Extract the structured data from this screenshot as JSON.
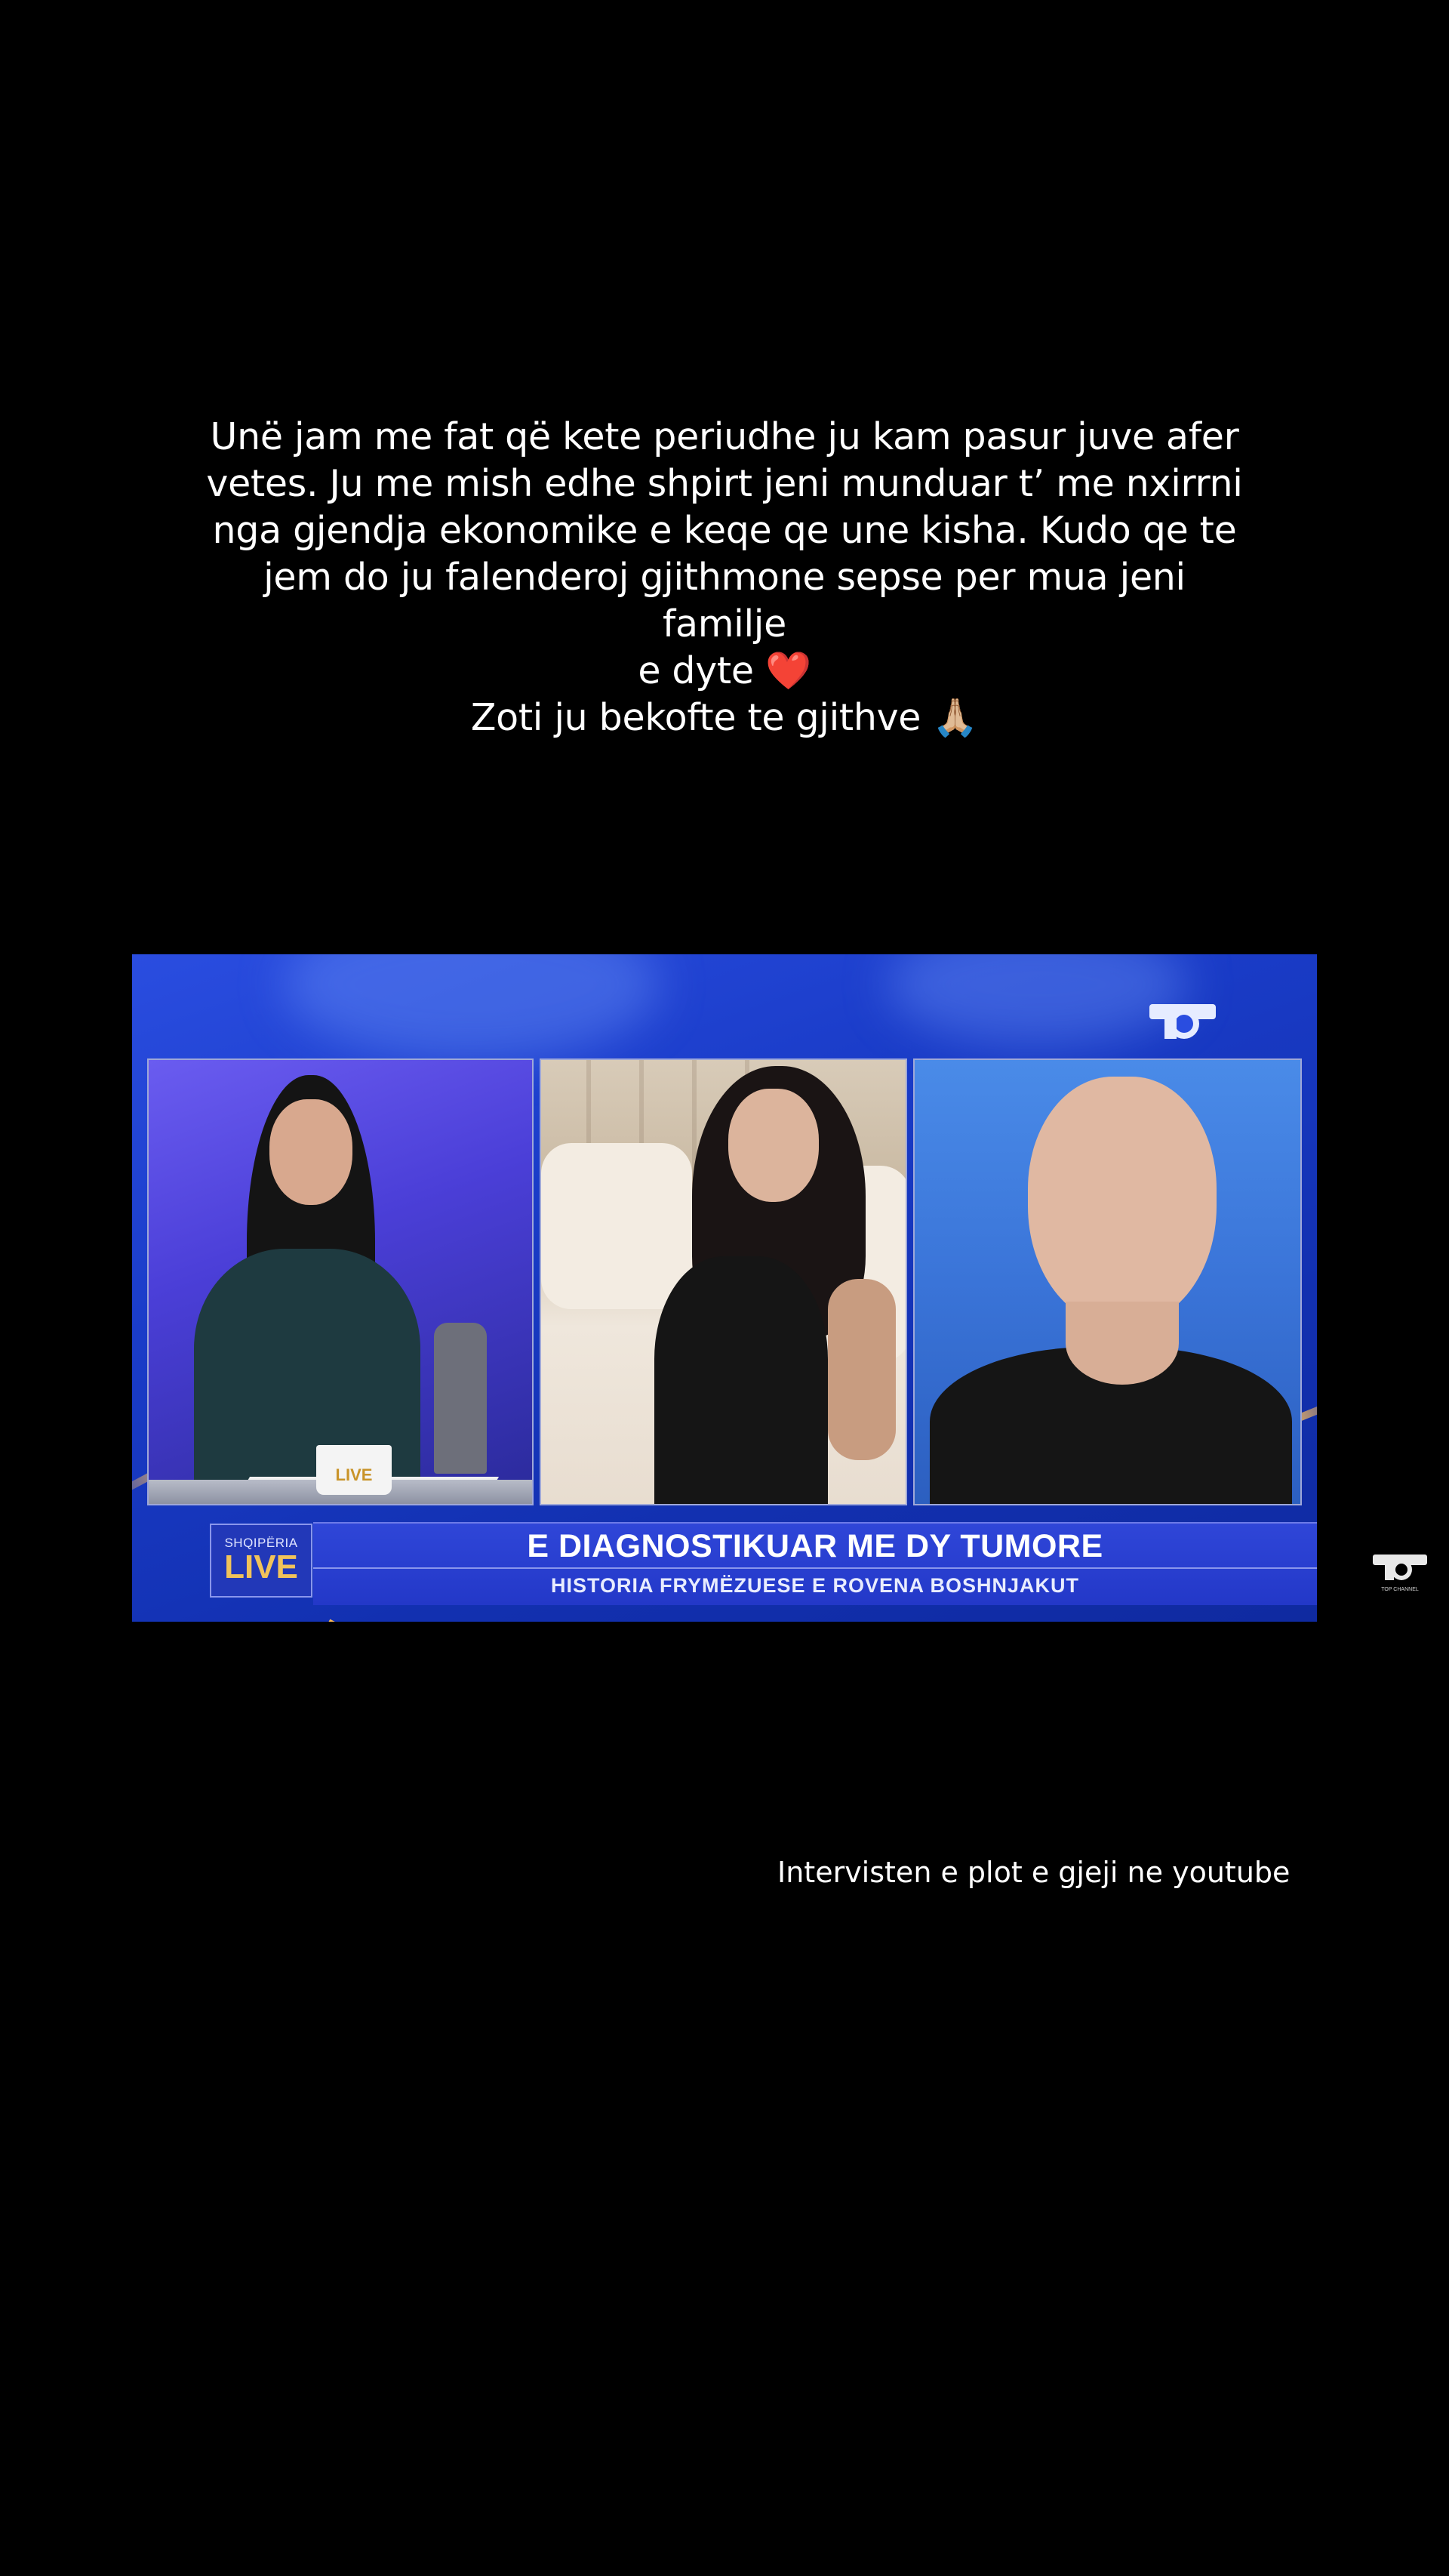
{
  "caption": {
    "line1": "Unë jam me fat që kete periudhe ju kam pasur juve afer",
    "line2": "vetes. Ju me mish edhe shpirt jeni munduar t’ me nxirrni",
    "line3": "nga gjendja ekonomike e keqe qe une kisha. Kudo qe te",
    "line4": "jem do ju falenderoj gjithmone sepse per mua jeni familje",
    "line5": "e dyte ❤️",
    "line6": "Zoti ju bekofte te gjithve 🙏🏼"
  },
  "video": {
    "lower_third": {
      "logo_small": "SHQIPËRIA",
      "logo_big": "LIVE",
      "title": "E DIAGNOSTIKUAR ME DY TUMORE",
      "subtitle": "HISTORIA FRYMËZUESE E ROVENA BOSHNJAKUT"
    },
    "mug_label": "LIVE",
    "brand_logo_icon": "top-channel-logo-icon"
  },
  "watermark": {
    "label": "TOP CHANNEL"
  },
  "bottom_text": "Intervisten e plot e gjeji ne youtube",
  "colors": {
    "background": "#000000",
    "studio_blue": "#1a3cc8",
    "accent_gold": "#f1c35a"
  }
}
